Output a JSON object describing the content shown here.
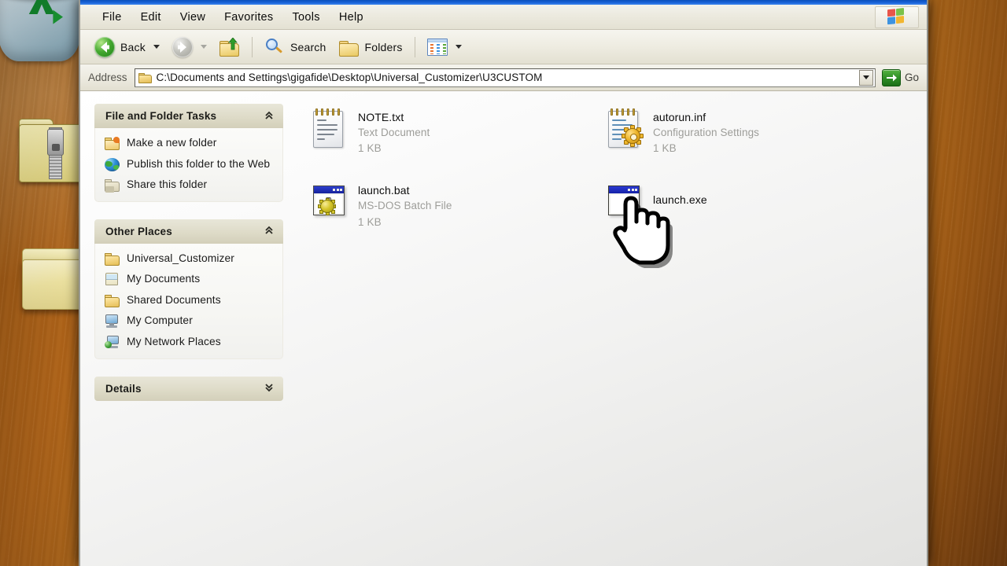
{
  "window": {
    "menubar": [
      "File",
      "Edit",
      "View",
      "Favorites",
      "Tools",
      "Help"
    ],
    "logo_icon": "windows-flag-icon"
  },
  "toolbar": {
    "back_label": "Back",
    "back_icon": "back-arrow-icon",
    "forward_icon": "forward-arrow-icon",
    "up_icon": "up-folder-icon",
    "search_label": "Search",
    "search_icon": "magnifier-icon",
    "folders_label": "Folders",
    "folders_icon": "folder-icon",
    "views_icon": "views-icon"
  },
  "address": {
    "label": "Address",
    "path": "C:\\Documents and Settings\\gigafide\\Desktop\\Universal_Customizer\\U3CUSTOM",
    "folder_icon": "folder-icon",
    "dropdown_icon": "chevron-down-icon",
    "go_label": "Go",
    "go_icon": "go-arrow-icon"
  },
  "sidebar": {
    "panels": [
      {
        "title": "File and Folder Tasks",
        "chevron": "«",
        "chevron_icon": "chevron-up-double-icon",
        "items": [
          {
            "label": "Make a new folder",
            "icon": "new-folder-icon"
          },
          {
            "label": "Publish this folder to the Web",
            "icon": "globe-icon"
          },
          {
            "label": "Share this folder",
            "icon": "shared-folder-icon"
          }
        ]
      },
      {
        "title": "Other Places",
        "chevron": "«",
        "chevron_icon": "chevron-up-double-icon",
        "items": [
          {
            "label": "Universal_Customizer",
            "icon": "folder-icon"
          },
          {
            "label": "My Documents",
            "icon": "my-documents-icon"
          },
          {
            "label": "Shared Documents",
            "icon": "folder-icon"
          },
          {
            "label": "My Computer",
            "icon": "my-computer-icon"
          },
          {
            "label": "My Network Places",
            "icon": "network-places-icon"
          }
        ]
      },
      {
        "title": "Details",
        "chevron": "»",
        "chevron_icon": "chevron-down-double-icon",
        "items": []
      }
    ]
  },
  "files": [
    {
      "name": "NOTE.txt",
      "type": "Text Document",
      "size": "1 KB",
      "icon": "text-document-icon"
    },
    {
      "name": "autorun.inf",
      "type": "Configuration Settings",
      "size": "1 KB",
      "icon": "config-settings-icon"
    },
    {
      "name": "launch.bat",
      "type": "MS-DOS Batch File",
      "size": "1 KB",
      "icon": "ms-dos-batch-icon"
    },
    {
      "name": "launch.exe",
      "type": "",
      "size": "",
      "icon": "application-icon"
    }
  ],
  "desktop": {
    "icons": [
      "recycle-bin-icon",
      "zip-folder-icon",
      "folder-icon"
    ]
  },
  "cursor": {
    "icon": "hand-pointer-cursor"
  },
  "colors": {
    "title_blue": "#1a63d8",
    "panel_header": "#dedbc8",
    "accent_green": "#2f8f26",
    "desktop_orange": "#d98b26"
  }
}
